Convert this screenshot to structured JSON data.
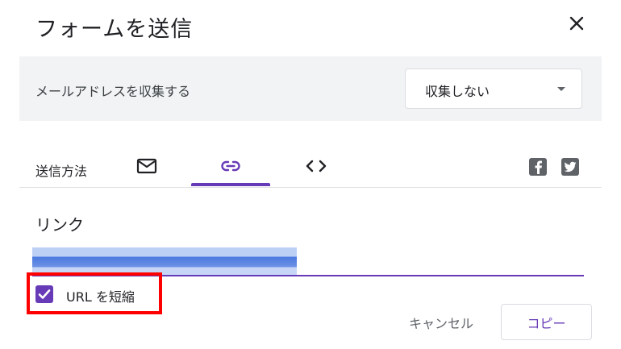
{
  "dialog": {
    "title": "フォームを送信"
  },
  "collect_email": {
    "label": "メールアドレスを収集する",
    "selected": "収集しない"
  },
  "send_method": {
    "label": "送信方法",
    "active_tab": "link"
  },
  "link": {
    "heading": "リンク"
  },
  "shorten_url": {
    "label": "URL を短縮",
    "checked": true
  },
  "actions": {
    "cancel_label": "キャンセル",
    "copy_label": "コピー"
  },
  "colors": {
    "accent": "#673ab7",
    "highlight": "#ff0000",
    "panel": "#f1f3f4"
  }
}
